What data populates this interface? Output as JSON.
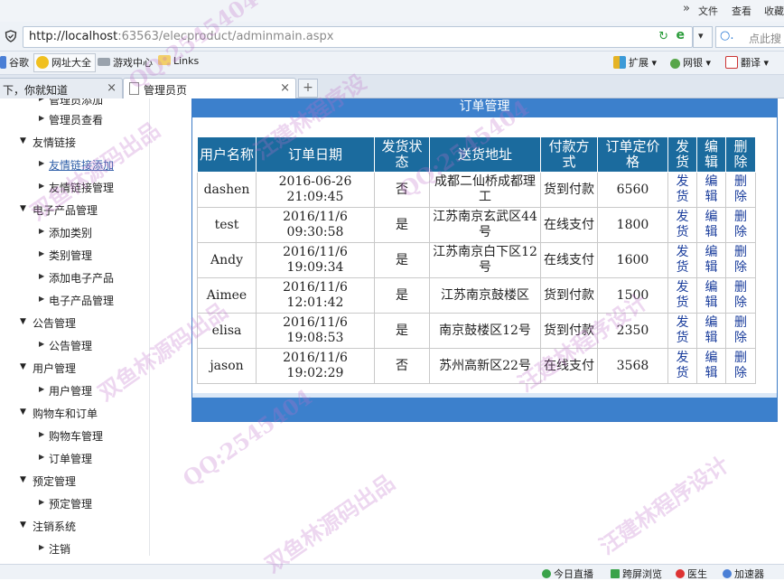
{
  "browser": {
    "menu": {
      "file": "文件",
      "view": "查看",
      "favorites": "收藏"
    },
    "url_host": "http://localhost",
    "url_rest": ":63563/elecproduct/adminmain.aspx",
    "search_placeholder": "点此搜",
    "favorites": [
      {
        "label": "谷歌",
        "icon": "google-icon"
      },
      {
        "label": "网址大全",
        "icon": "site-nav-icon"
      },
      {
        "label": "游戏中心",
        "icon": "gamepad-icon"
      },
      {
        "label": "Links",
        "icon": "folder-icon"
      }
    ],
    "toolbar_right": {
      "extend": "扩展",
      "bank": "网银",
      "translate": "翻译"
    },
    "tabs": [
      {
        "label": "下，你就知道",
        "active": false
      },
      {
        "label": "管理员页",
        "active": true
      }
    ],
    "status": {
      "today": "今日直播",
      "screen": "跨屏浏览",
      "doctor": "医生",
      "accelerator": "加速器"
    }
  },
  "sidebar": {
    "partial_top": "管理员添加",
    "items": [
      {
        "type": "sub",
        "label": "管理员查看"
      },
      {
        "type": "cat",
        "label": "友情链接"
      },
      {
        "type": "sub",
        "label": "友情链接添加",
        "link": true
      },
      {
        "type": "sub",
        "label": "友情链接管理"
      },
      {
        "type": "cat",
        "label": "电子产品管理"
      },
      {
        "type": "sub",
        "label": "添加类别"
      },
      {
        "type": "sub",
        "label": "类别管理"
      },
      {
        "type": "sub",
        "label": "添加电子产品"
      },
      {
        "type": "sub",
        "label": "电子产品管理"
      },
      {
        "type": "cat",
        "label": "公告管理"
      },
      {
        "type": "sub",
        "label": "公告管理"
      },
      {
        "type": "cat",
        "label": "用户管理"
      },
      {
        "type": "sub",
        "label": "用户管理"
      },
      {
        "type": "cat",
        "label": "购物车和订单"
      },
      {
        "type": "sub",
        "label": "购物车管理"
      },
      {
        "type": "sub",
        "label": "订单管理"
      },
      {
        "type": "cat",
        "label": "预定管理"
      },
      {
        "type": "sub",
        "label": "预定管理"
      },
      {
        "type": "cat",
        "label": "注销系统"
      },
      {
        "type": "sub",
        "label": "注销"
      }
    ]
  },
  "orders": {
    "title": "订单管理",
    "headers": [
      "用户名称",
      "订单日期",
      "发货状态",
      "送货地址",
      "付款方式",
      "订单定价格",
      "发货",
      "编辑",
      "删除"
    ],
    "rows": [
      {
        "user": "dashen",
        "date": "2016-06-26 21:09:45",
        "shipped": "否",
        "address": "成都二仙桥成都理工",
        "payment": "货到付款",
        "price": "6560",
        "ship": "发货",
        "edit": "编辑",
        "delete": "删除"
      },
      {
        "user": "test",
        "date": "2016/11/6 09:30:58",
        "shipped": "是",
        "address": "江苏南京玄武区44号",
        "payment": "在线支付",
        "price": "1800",
        "ship": "发货",
        "edit": "编辑",
        "delete": "删除"
      },
      {
        "user": "Andy",
        "date": "2016/11/6 19:09:34",
        "shipped": "是",
        "address": "江苏南京白下区12号",
        "payment": "在线支付",
        "price": "1600",
        "ship": "发货",
        "edit": "编辑",
        "delete": "删除"
      },
      {
        "user": "Aimee",
        "date": "2016/11/6 12:01:42",
        "shipped": "是",
        "address": "江苏南京鼓楼区",
        "payment": "货到付款",
        "price": "1500",
        "ship": "发货",
        "edit": "编辑",
        "delete": "删除"
      },
      {
        "user": "elisa",
        "date": "2016/11/6 19:08:53",
        "shipped": "是",
        "address": "南京鼓楼区12号",
        "payment": "货到付款",
        "price": "2350",
        "ship": "发货",
        "edit": "编辑",
        "delete": "删除"
      },
      {
        "user": "jason",
        "date": "2016/11/6 19:02:29",
        "shipped": "否",
        "address": "苏州高新区22号",
        "payment": "在线支付",
        "price": "3568",
        "ship": "发货",
        "edit": "编辑",
        "delete": "删除"
      }
    ]
  },
  "watermarks": [
    "QQ:2545404",
    "汪建林程序设",
    "双鱼林源码出品",
    "QQ:2545404",
    "双鱼林源码出品",
    "汪建林程序设计",
    "QQ:2545404",
    "双鱼林源码出品",
    "汪建林程序设计"
  ],
  "colors": {
    "header_blue": "#1b6b9e",
    "panel_blue": "#3c80cc",
    "link_blue": "#1a3d9c"
  }
}
